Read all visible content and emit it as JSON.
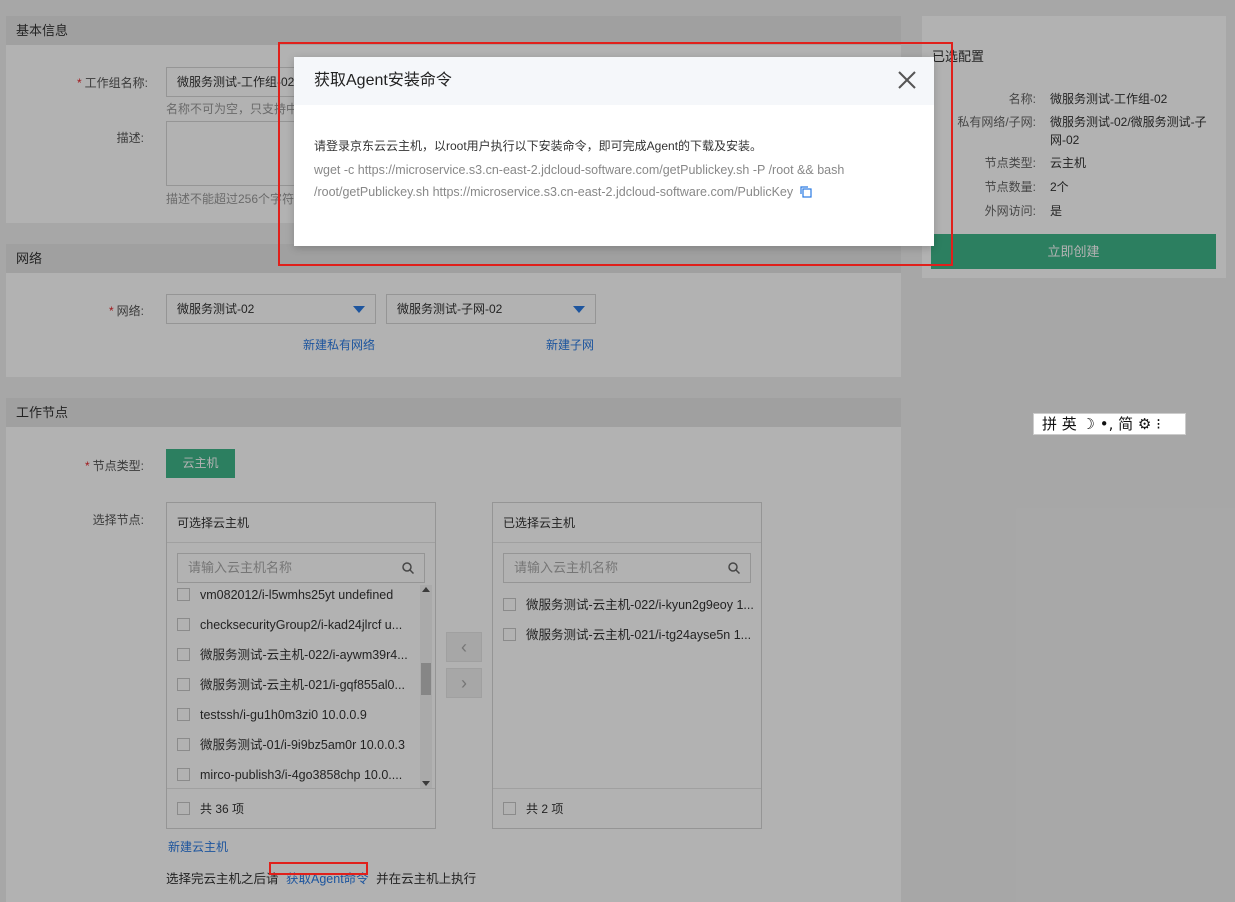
{
  "basic_info": {
    "title": "基本信息",
    "name_label": "工作组名称:",
    "name_value": "微服务测试-工作组-02",
    "name_hint": "名称不可为空，只支持中",
    "desc_label": "描述:",
    "desc_hint": "描述不能超过256个字符"
  },
  "network": {
    "title": "网络",
    "label": "网络:",
    "vpc_value": "微服务测试-02",
    "subnet_value": "微服务测试-子网-02",
    "new_vpc_link": "新建私有网络",
    "new_subnet_link": "新建子网"
  },
  "worker": {
    "title": "工作节点",
    "node_type_label": "节点类型:",
    "node_type_button": "云主机",
    "select_label": "选择节点:",
    "available": {
      "title": "可选择云主机",
      "search_placeholder": "请输入云主机名称",
      "items": [
        "vm082012/i-l5wmhs25yt undefined",
        "checksecurityGroup2/i-kad24jlrcf u...",
        "微服务测试-云主机-022/i-aywm39r4...",
        "微服务测试-云主机-021/i-gqf855al0...",
        "testssh/i-gu1h0m3zi0 10.0.0.9",
        "微服务测试-01/i-9i9bz5am0r 10.0.0.3",
        "mirco-publish3/i-4go3858chp 10.0...."
      ],
      "footer": "共 36 项"
    },
    "selected": {
      "title": "已选择云主机",
      "search_placeholder": "请输入云主机名称",
      "items": [
        "微服务测试-云主机-022/i-kyun2g9eoy 1...",
        "微服务测试-云主机-021/i-tg24ayse5n 1..."
      ],
      "footer": "共 2 项"
    },
    "new_vm_link": "新建云主机",
    "footer_prefix": "选择完云主机之后请",
    "footer_link": "获取Agent命令",
    "footer_suffix": "并在云主机上执行"
  },
  "summary": {
    "title": "已选配置",
    "rows": [
      {
        "key": "名称:",
        "value": "微服务测试-工作组-02"
      },
      {
        "key": "私有网络/子网:",
        "value": "微服务测试-02/微服务测试-子网-02"
      },
      {
        "key": "节点类型:",
        "value": "云主机"
      },
      {
        "key": "节点数量:",
        "value": "2个"
      },
      {
        "key": "外网访问:",
        "value": "是"
      }
    ],
    "create_button": "立即创建"
  },
  "modal": {
    "title": "获取Agent安装命令",
    "intro": "请登录京东云云主机，以root用户执行以下安装命令，即可完成Agent的下载及安装。",
    "command_line1": "wget -c https://microservice.s3.cn-east-2.jdcloud-software.com/getPublickey.sh -P /root && bash",
    "command_line2": "/root/getPublickey.sh https://microservice.s3.cn-east-2.jdcloud-software.com/PublicKey"
  },
  "ime_toolbar": {
    "text": "拼 英 ☽ •, 简 ⚙ ⁝"
  }
}
